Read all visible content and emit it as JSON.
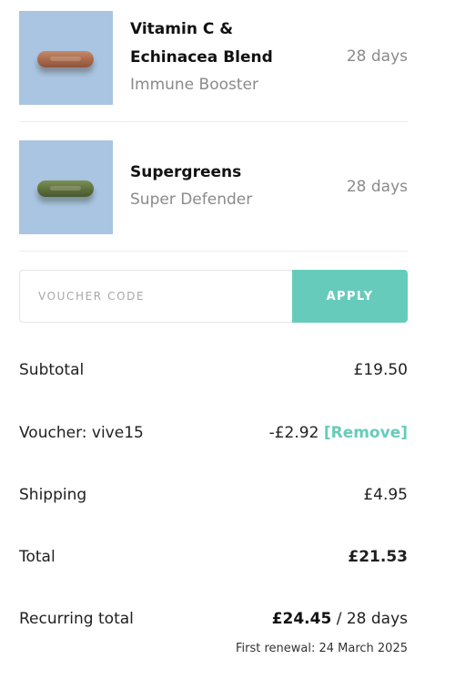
{
  "products": [
    {
      "name": "Vitamin C & Echinacea Blend",
      "subtitle": "Immune Booster",
      "duration": "28 days",
      "image_icon": "orange-capsule-image"
    },
    {
      "name": "Supergreens",
      "subtitle": "Super Defender",
      "duration": "28 days",
      "image_icon": "green-capsule-image"
    }
  ],
  "voucher": {
    "placeholder": "VOUCHER CODE",
    "value": "",
    "apply_label": "APPLY"
  },
  "summary": {
    "subtotal_label": "Subtotal",
    "subtotal_value": "£19.50",
    "voucher_label": "Voucher: vive15",
    "voucher_value": "-£2.92",
    "remove_label": "[Remove]",
    "shipping_label": "Shipping",
    "shipping_value": "£4.95",
    "total_label": "Total",
    "total_value": "£21.53",
    "recurring_label": "Recurring total",
    "recurring_value": "£24.45",
    "recurring_period": " / 28 days",
    "renewal_text": "First renewal: 24 March 2025"
  },
  "colors": {
    "accent": "#67cbbb",
    "thumbnail_bg": "#a9c5e1",
    "muted_text": "#8a8a8a"
  }
}
